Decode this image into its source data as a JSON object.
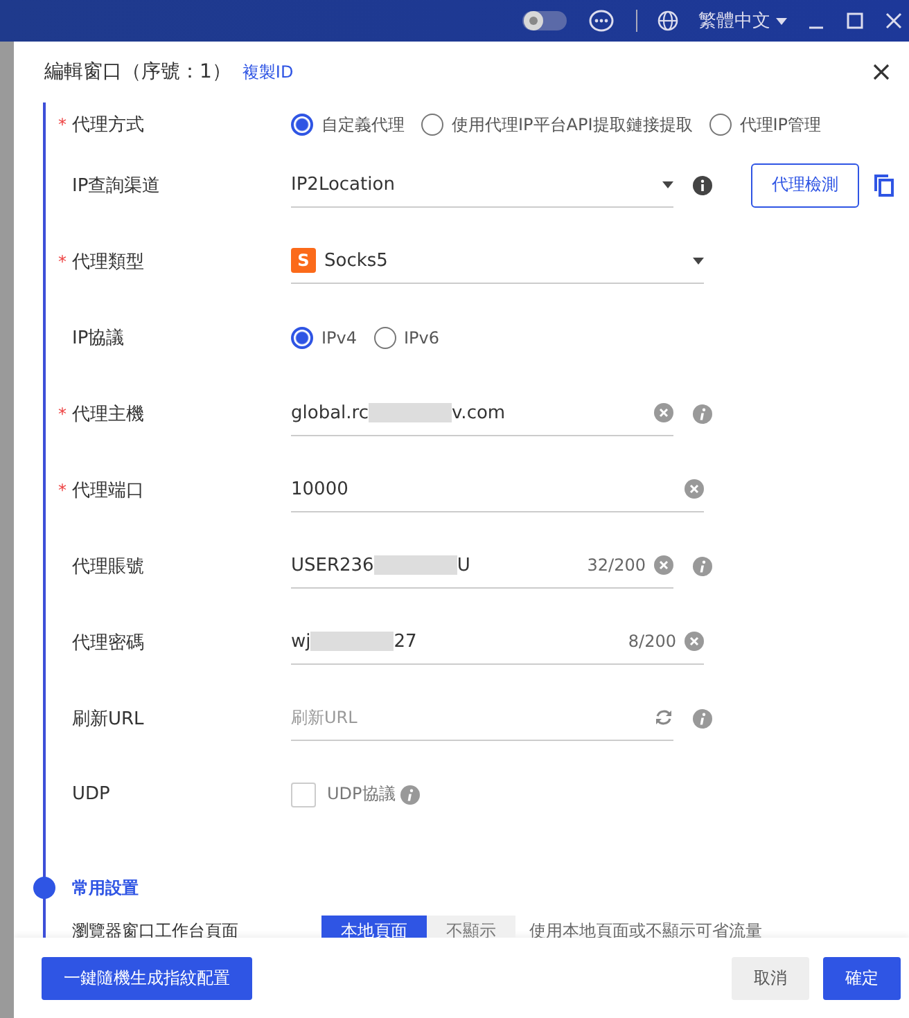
{
  "topbar": {
    "language": "繁體中文"
  },
  "dialog": {
    "title": "編輯窗口（序號：1）",
    "copy_link": "複製ID"
  },
  "fields": [
    {
      "kind": "radio",
      "label": "代理方式",
      "required_mark": "*",
      "options": [
        {
          "label": "自定義代理",
          "selected": true
        },
        {
          "label": "使用代理IP平台API提取鏈接提取",
          "selected": false
        },
        {
          "label": "代理IP管理",
          "selected": false
        }
      ]
    },
    {
      "kind": "select",
      "label": "IP查詢渠道",
      "value": "IP2Location",
      "info": true,
      "button": "代理檢測"
    },
    {
      "kind": "select",
      "label": "代理類型",
      "required_mark": "*",
      "value": "Socks5",
      "badge": "S"
    },
    {
      "kind": "radio",
      "label": "IP協議",
      "options": [
        {
          "label": "IPv4",
          "selected": true
        },
        {
          "label": "IPv6",
          "selected": false
        }
      ]
    },
    {
      "kind": "text",
      "label": "代理主機",
      "required_mark": "*",
      "value": "global.rc",
      "value_tail": "v.com",
      "redacted": true,
      "clearable": true,
      "info": true
    },
    {
      "kind": "text",
      "label": "代理端口",
      "required_mark": "*",
      "value": "10000",
      "clearable": true
    },
    {
      "kind": "text",
      "label": "代理賬號",
      "value": "USER236",
      "value_tail": "U",
      "redacted": true,
      "count": "32/200",
      "clearable": true,
      "info": true
    },
    {
      "kind": "text",
      "label": "代理密碼",
      "value": "wj",
      "value_tail": "27",
      "redacted": true,
      "count": "8/200",
      "clearable": true
    },
    {
      "kind": "text",
      "label": "刷新URL",
      "placeholder": "刷新URL",
      "refresh": true,
      "info": true
    },
    {
      "kind": "checkbox",
      "label": "UDP",
      "option": "UDP協議",
      "checked": false,
      "info": true
    }
  ],
  "section": {
    "title": "常用設置",
    "rows": [
      {
        "label": "瀏覽器窗口工作台頁面",
        "segments": [
          {
            "label": "本地頁面",
            "selected": true
          },
          {
            "label": "不顯示",
            "selected": false
          }
        ],
        "hint": "使用本地頁面或不顯示可省流量"
      }
    ]
  },
  "footer": {
    "generate": "一鍵隨機生成指紋配置",
    "cancel": "取消",
    "confirm": "確定"
  }
}
